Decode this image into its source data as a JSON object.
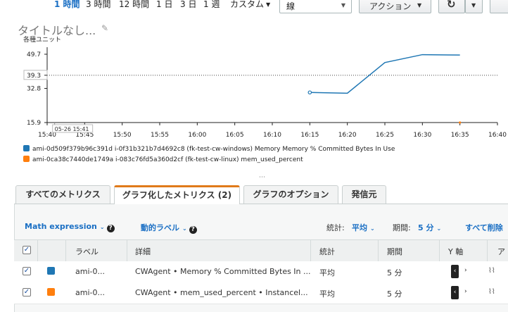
{
  "timerange": {
    "items": [
      {
        "label": "1 時間",
        "active": true
      },
      {
        "label": "3 時間"
      },
      {
        "label": "12 時間"
      },
      {
        "label": "1 日"
      },
      {
        "label": "3 日"
      },
      {
        "label": "1 週"
      }
    ],
    "custom_label": "カスタム"
  },
  "graph_type": {
    "value": "線"
  },
  "actions_label": "アクション",
  "chart": {
    "title": "タイトルなし...",
    "units": "各種ユニット"
  },
  "chart_data": {
    "type": "line",
    "ylabel": "各種ユニット",
    "ylim": [
      15.9,
      49.7
    ],
    "yticks": [
      15.9,
      32.8,
      39.3,
      49.7
    ],
    "xticks": [
      "15:40",
      "15:45",
      "15:50",
      "15:55",
      "16:00",
      "16:05",
      "16:10",
      "16:15",
      "16:20",
      "16:25",
      "16:30",
      "16:35",
      "16:40"
    ],
    "tooltip": "05-26 15:41",
    "threshold": 39.3,
    "series": [
      {
        "name": "ami-0d509f379b96c391d i-0f31b321b7d4692c8 (fk-test-cw-windows) Memory Memory % Committed Bytes In Use",
        "color": "#1f77b4",
        "x": [
          "16:15",
          "16:20",
          "16:25",
          "16:30",
          "16:35"
        ],
        "y": [
          30.8,
          30.4,
          45.6,
          49.5,
          49.3
        ]
      },
      {
        "name": "ami-0ca38c7440de1749a i-083c76fd5a360d2cf (fk-test-cw-linux) mem_used_percent",
        "color": "#ff7f0e",
        "x": [
          "16:35"
        ],
        "y": [
          15.9
        ]
      }
    ]
  },
  "tabs": [
    {
      "label": "すべてのメトリクス"
    },
    {
      "label": "グラフ化したメトリクス (2)",
      "active": true
    },
    {
      "label": "グラフのオプション"
    },
    {
      "label": "発信元"
    }
  ],
  "toolbar": {
    "math_label": "Math expression",
    "dynamic_label": "動的ラベル",
    "stat_label": "統計:",
    "stat_value": "平均",
    "period_label": "期間:",
    "period_value": "5 分",
    "remove_all": "すべて削除"
  },
  "table": {
    "headers": {
      "label": "ラベル",
      "details": "詳細",
      "stat": "統計",
      "period": "期間",
      "yaxis": "Y 軸",
      "actions": "ア"
    },
    "rows": [
      {
        "color": "#1f77b4",
        "label": "ami-0...",
        "details": "CWAgent • Memory % Committed Bytes In ...",
        "stat": "平均",
        "period": "5 分"
      },
      {
        "color": "#ff7f0e",
        "label": "ami-0...",
        "details": "CWAgent • mem_used_percent • Instancel...",
        "stat": "平均",
        "period": "5 分"
      }
    ]
  }
}
